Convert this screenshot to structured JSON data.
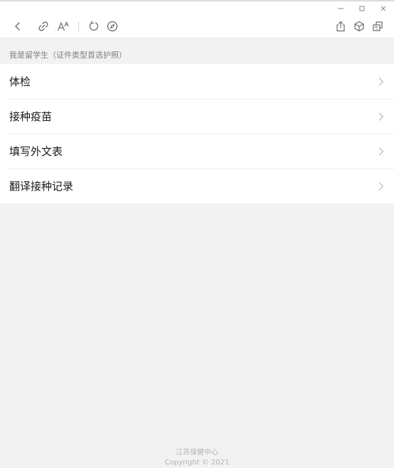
{
  "section": {
    "header": "我是留学生（证件类型首选护照）"
  },
  "menu": {
    "items": [
      {
        "label": "体检"
      },
      {
        "label": "接种疫苗"
      },
      {
        "label": "填写外文表"
      },
      {
        "label": "翻译接种记录"
      }
    ]
  },
  "footer": {
    "org": "江苏保健中心",
    "copyright": "Copyright © 2021"
  },
  "colors": {
    "page_background": "#f2f2f2",
    "card_background": "#ffffff",
    "icon_gray": "#6b6b6b",
    "text_primary": "#1a1a1a",
    "text_secondary": "#7f7f7f"
  },
  "icons": {
    "toolbar_left": [
      "back-icon",
      "link-icon",
      "font-size-icon",
      "refresh-icon",
      "compass-icon"
    ],
    "toolbar_right": [
      "share-icon",
      "cube-icon",
      "mini-program-icon"
    ],
    "window": [
      "minimize-icon",
      "maximize-icon",
      "close-icon"
    ]
  }
}
